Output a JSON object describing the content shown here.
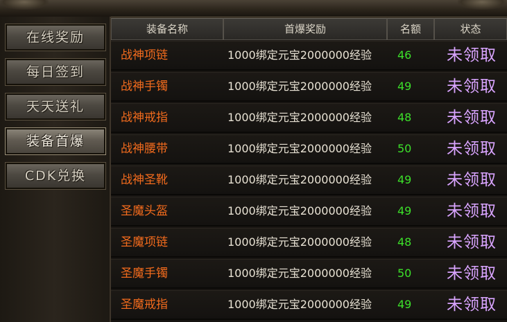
{
  "sidebar": {
    "items": [
      {
        "label": "在线奖励",
        "active": false
      },
      {
        "label": "每日签到",
        "active": false
      },
      {
        "label": "天天送礼",
        "active": false
      },
      {
        "label": "装备首爆",
        "active": true
      },
      {
        "label": "CDK兑换",
        "active": false
      }
    ]
  },
  "table": {
    "headers": [
      "装备名称",
      "首爆奖励",
      "名额",
      "状态"
    ],
    "rows": [
      {
        "name": "战神项链",
        "reward": "1000绑定元宝2000000经验",
        "count": "46",
        "status": "未领取"
      },
      {
        "name": "战神手镯",
        "reward": "1000绑定元宝2000000经验",
        "count": "49",
        "status": "未领取"
      },
      {
        "name": "战神戒指",
        "reward": "1000绑定元宝2000000经验",
        "count": "48",
        "status": "未领取"
      },
      {
        "name": "战神腰带",
        "reward": "1000绑定元宝2000000经验",
        "count": "50",
        "status": "未领取"
      },
      {
        "name": "战神圣靴",
        "reward": "1000绑定元宝2000000经验",
        "count": "49",
        "status": "未领取"
      },
      {
        "name": "圣魔头盔",
        "reward": "1000绑定元宝2000000经验",
        "count": "49",
        "status": "未领取"
      },
      {
        "name": "圣魔项链",
        "reward": "1000绑定元宝2000000经验",
        "count": "48",
        "status": "未领取"
      },
      {
        "name": "圣魔手镯",
        "reward": "1000绑定元宝2000000经验",
        "count": "50",
        "status": "未领取"
      },
      {
        "name": "圣魔戒指",
        "reward": "1000绑定元宝2000000经验",
        "count": "49",
        "status": "未领取"
      }
    ]
  },
  "colors": {
    "name": "#f26b1d",
    "reward": "#e8e2d4",
    "count": "#3ce02a",
    "status": "#d9a4ff"
  }
}
